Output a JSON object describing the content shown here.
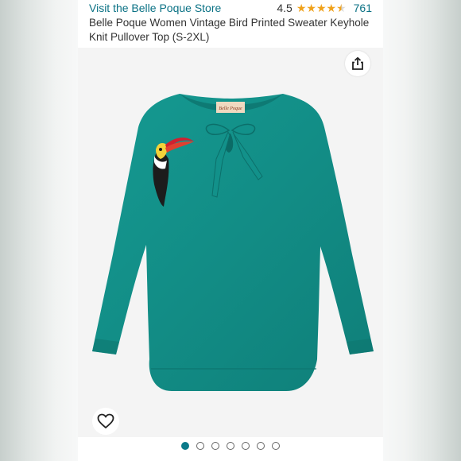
{
  "header": {
    "store_link": "Visit the Belle Poque Store",
    "rating": "4.5",
    "rating_count": "761",
    "stars": 4.5,
    "title": "Belle Poque Women Vintage Bird Printed Sweater Keyhole Knit Pullover Top (S-2XL)"
  },
  "product_image": {
    "label_text": "Belle Poque",
    "colors": {
      "sweater": "#128d86",
      "accent": "#0a7a8a",
      "toucan_beak": "#d02030",
      "toucan_yellow": "#f2d23a"
    }
  },
  "icons": {
    "share": "share-icon",
    "favorite": "heart-icon"
  },
  "carousel": {
    "count": 7,
    "active_index": 0
  }
}
